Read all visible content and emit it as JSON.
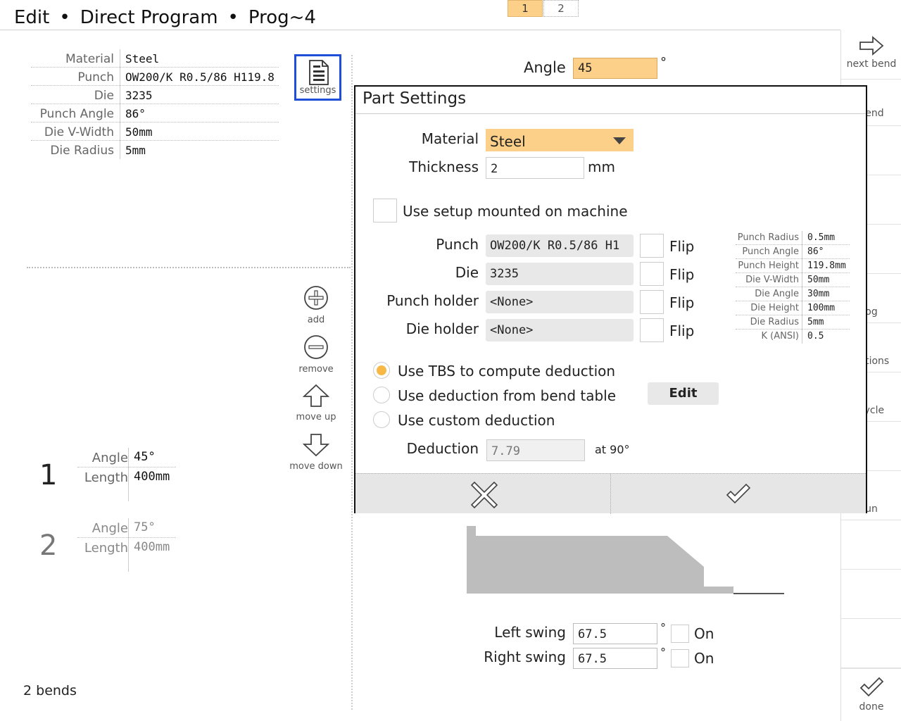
{
  "header": {
    "crumb_1": "Edit",
    "separator": "•",
    "crumb_2": "Direct Program",
    "crumb_3": "Prog~4",
    "pages": [
      "1",
      "2"
    ]
  },
  "tooling_info": [
    {
      "label": "Material",
      "value": "Steel"
    },
    {
      "label": "Punch",
      "value": "OW200/K R0.5/86 H119.8"
    },
    {
      "label": "Die",
      "value": "3235"
    },
    {
      "label": "Punch Angle",
      "value": "86°"
    },
    {
      "label": "Die V-Width",
      "value": "50mm"
    },
    {
      "label": "Die Radius",
      "value": "5mm"
    }
  ],
  "settings_button": {
    "label": "settings",
    "icon": "document-icon"
  },
  "side_tools": {
    "add": "add",
    "remove": "remove",
    "move_up": "move up",
    "move_down": "move down"
  },
  "bends": [
    {
      "number": "1",
      "angle_label": "Angle",
      "angle": "45°",
      "length_label": "Length",
      "length": "400mm"
    },
    {
      "number": "2",
      "angle_label": "Angle",
      "angle": "75°",
      "length_label": "Length",
      "length": "400mm"
    }
  ],
  "bends_count": "2 bends",
  "center": {
    "angle_label": "Angle",
    "angle_value": "45",
    "degree": "°",
    "left_swing_label": "Left swing",
    "left_swing_value": "67.5",
    "right_swing_label": "Right swing",
    "right_swing_value": "67.5",
    "on_label": "On"
  },
  "right_toolbar": {
    "next_bend": "next bend",
    "prev_bend": "bend",
    "item_fragment_1": "og",
    "item_fragment_2": "ections",
    "item_fragment_3": "cycle",
    "item_fragment_4": "un",
    "done": "done"
  },
  "dialog": {
    "title": "Part Settings",
    "material_label": "Material",
    "material_value": "Steel",
    "thickness_label": "Thickness",
    "thickness_value": "2",
    "thickness_unit": "mm",
    "use_setup_label": "Use setup mounted on machine",
    "punch_label": "Punch",
    "punch_value": "OW200/K R0.5/86 H1",
    "die_label": "Die",
    "die_value": "3235",
    "punch_holder_label": "Punch holder",
    "punch_holder_value": "<None>",
    "die_holder_label": "Die holder",
    "die_holder_value": "<None>",
    "flip_label": "Flip",
    "specs": [
      {
        "label": "Punch Radius",
        "value": "0.5mm"
      },
      {
        "label": "Punch Angle",
        "value": "86°"
      },
      {
        "label": "Punch Height",
        "value": "119.8mm"
      },
      {
        "label": "Die V-Width",
        "value": "50mm"
      },
      {
        "label": "Die Angle",
        "value": "30mm"
      },
      {
        "label": "Die Height",
        "value": "100mm"
      },
      {
        "label": "Die Radius",
        "value": "5mm"
      },
      {
        "label": "K (ANSI)",
        "value": "0.5"
      }
    ],
    "deduction_options": [
      {
        "label": "Use TBS to compute deduction",
        "selected": true
      },
      {
        "label": "Use deduction from bend table",
        "selected": false
      },
      {
        "label": "Use custom deduction",
        "selected": false
      }
    ],
    "edit_label": "Edit",
    "deduction_label": "Deduction",
    "deduction_value": "7.79",
    "deduction_at": "at 90°",
    "cancel_icon": "close-icon",
    "confirm_icon": "check-icon"
  },
  "colors": {
    "accent": "#fdd08a",
    "radio_selected": "#f7b846",
    "focus_border": "#1f4fd8",
    "part_fill": "#bdbdbd"
  }
}
